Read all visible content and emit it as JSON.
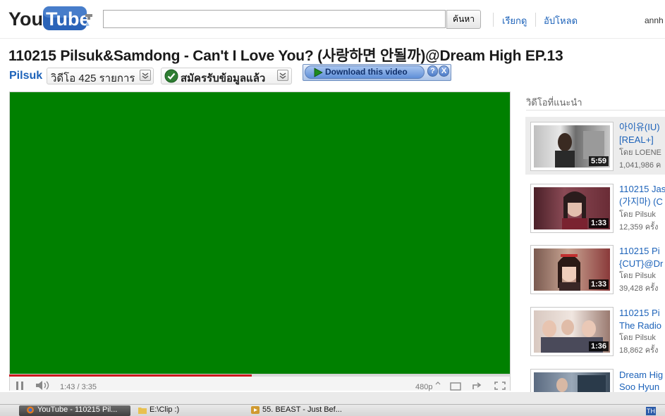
{
  "header": {
    "logo_text_you": "You",
    "logo_text_tube": "Tube",
    "search_value": "",
    "search_button": "ค้นหา",
    "nav_links": [
      "เรียกดู",
      "อัปโหลด"
    ],
    "username": "annh"
  },
  "video": {
    "title": "110215 Pilsuk&Samdong - Can't I Love You? (사랑하면 안될까)@Dream High EP.13",
    "channel": "Pilsuk",
    "video_count": "วิดีโอ 425 รายการ",
    "subscribed_label": "สมัครรับข้อมูลแล้ว",
    "download_label": "Download this video",
    "help_label": "?",
    "close_label": "X"
  },
  "player": {
    "background_color": "#008000",
    "progress_played_fraction": 0.484,
    "time": "1:43 / 3:35",
    "quality": "480p"
  },
  "sidebar": {
    "title": "วิดีโอที่แนะนำ",
    "items": [
      {
        "line1": "아이유(IU)",
        "line2": "[REAL+]",
        "by": "โดย LOENE",
        "views": "1,041,986 ค",
        "duration": "5:59",
        "highlighted": true
      },
      {
        "line1": "110215 Jas",
        "line2": "(가지마) (C",
        "by": "โดย Pilsuk",
        "views": "12,359 ครั้ง",
        "duration": "1:33",
        "highlighted": false
      },
      {
        "line1": "110215 Pi",
        "line2": "{CUT}@Dr",
        "by": "โดย Pilsuk",
        "views": "39,428 ครั้ง",
        "duration": "1:33",
        "highlighted": false
      },
      {
        "line1": "110215 Pi",
        "line2": "The Radio",
        "by": "โดย Pilsuk",
        "views": "18,862 ครั้ง",
        "duration": "1:36",
        "highlighted": false
      },
      {
        "line1": "Dream Hig",
        "line2": "Soo Hyun",
        "by": "",
        "views": "",
        "duration": "",
        "highlighted": false
      }
    ]
  },
  "taskbar": {
    "tasks": [
      "YouTube - 110215 Pil...",
      "E:\\Clip :)",
      "55. BEAST - Just Bef..."
    ],
    "tray": "TH"
  }
}
